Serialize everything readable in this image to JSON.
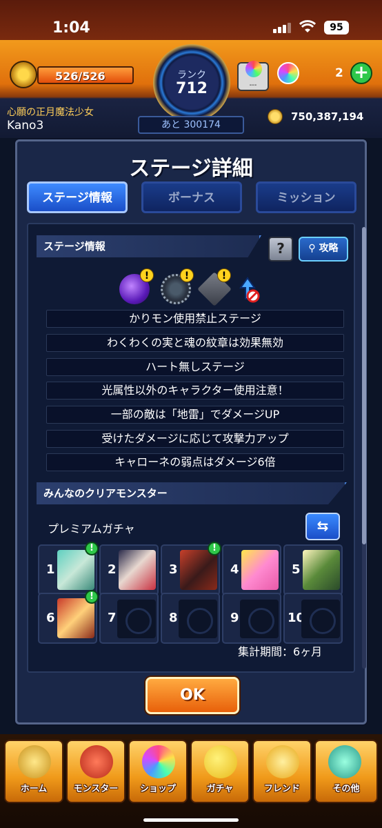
{
  "status": {
    "time": "1:04",
    "battery": "95"
  },
  "hud": {
    "stamina": "526/526",
    "rank_label": "ランク",
    "rank": "712",
    "next": "あと 300174",
    "stack_label": "---",
    "orb_count": "2",
    "title": "心願の正月魔法少女",
    "player": "Kano3",
    "coins": "750,387,194"
  },
  "dialog": {
    "title": "ステージ詳細",
    "tabs": [
      {
        "label": "ステージ情報",
        "active": true
      },
      {
        "label": "ボーナス",
        "active": false
      },
      {
        "label": "ミッション",
        "active": false
      }
    ],
    "stage_info_header": "ステージ情報",
    "help_label": "?",
    "attack_label": "攻略",
    "rules": [
      "かりモン使用禁止ステージ",
      "わくわくの実と魂の紋章は効果無効",
      "ハート無しステージ",
      "光属性以外のキャラクター使用注意！",
      "一部の敵は「地雷」でダメージUP",
      "受けたダメージに応じて攻撃力アップ",
      "キャローネの弱点はダメージ6倍"
    ],
    "clear_header": "みんなのクリアモンスター",
    "premium_label": "プレミアムガチャ",
    "swap_label": "⇆",
    "slots": [
      {
        "num": "1",
        "filled": true,
        "alert": true
      },
      {
        "num": "2",
        "filled": true,
        "alert": false
      },
      {
        "num": "3",
        "filled": true,
        "alert": true
      },
      {
        "num": "4",
        "filled": true,
        "alert": false
      },
      {
        "num": "5",
        "filled": true,
        "alert": false
      },
      {
        "num": "6",
        "filled": true,
        "alert": true
      },
      {
        "num": "7",
        "filled": false,
        "alert": false
      },
      {
        "num": "8",
        "filled": false,
        "alert": false
      },
      {
        "num": "9",
        "filled": false,
        "alert": false
      },
      {
        "num": "10",
        "filled": false,
        "alert": false
      }
    ],
    "period": "集計期間：6ヶ月",
    "ok_label": "OK"
  },
  "nav": [
    {
      "label": "ホーム",
      "icon": "home-icon",
      "color": "#f0c040"
    },
    {
      "label": "モンスター",
      "icon": "monster-icon",
      "color": "#d83a2a"
    },
    {
      "label": "ショップ",
      "icon": "shop-orb-icon",
      "color": "#b46aff"
    },
    {
      "label": "ガチャ",
      "icon": "gacha-egg-icon",
      "color": "#ffe24a"
    },
    {
      "label": "フレンド",
      "icon": "friend-balloon-icon",
      "color": "#ffd04a"
    },
    {
      "label": "その他",
      "icon": "other-icon",
      "color": "#4ac8b0"
    }
  ]
}
